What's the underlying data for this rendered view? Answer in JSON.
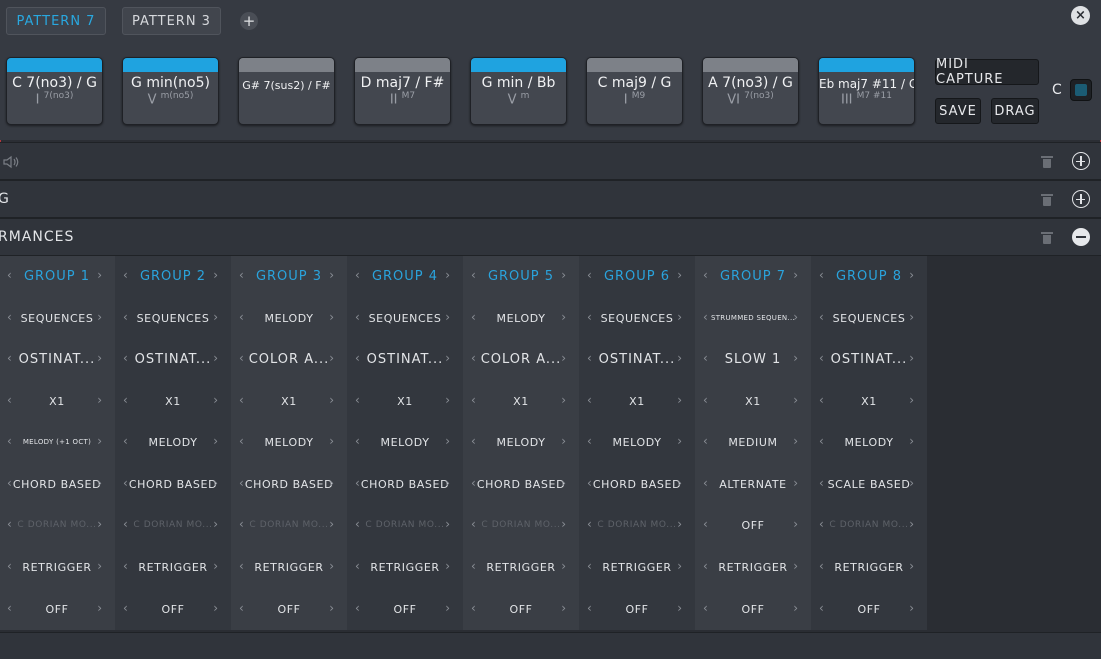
{
  "tabs": [
    {
      "label": "PATTERN 7",
      "active": true
    },
    {
      "label": "PATTERN 3",
      "active": false
    }
  ],
  "add_tab_symbol": "+",
  "close_symbol": "×",
  "chords": [
    {
      "name": "C 7(no3) / G",
      "roman": "I",
      "ext": "7(no3)",
      "selected": true
    },
    {
      "name": "G min(no5)",
      "roman": "V",
      "ext": "m(no5)",
      "selected": true
    },
    {
      "name": "G# 7(sus2) / F#",
      "roman": "",
      "ext": "",
      "selected": false
    },
    {
      "name": "D maj7 / F#",
      "roman": "II",
      "ext": "M7",
      "selected": false
    },
    {
      "name": "G min / Bb",
      "roman": "V",
      "ext": "m",
      "selected": true
    },
    {
      "name": "C maj9 / G",
      "roman": "I",
      "ext": "M9",
      "selected": false
    },
    {
      "name": "A 7(no3) / G",
      "roman": "VI",
      "ext": "7(no3)",
      "selected": false
    },
    {
      "name": "Eb maj7 #11 / G",
      "roman": "III",
      "ext": "M7 #11",
      "selected": true
    }
  ],
  "buttons": {
    "midi_capture": "MIDI CAPTURE",
    "save": "SAVE",
    "drag": "DRAG"
  },
  "key_label": "C",
  "sections": [
    {
      "label": "",
      "icon": "speaker-icon",
      "expanded": false
    },
    {
      "label": "G",
      "icon": "",
      "expanded": false
    },
    {
      "label": "RMANCES",
      "icon": "",
      "expanded": true
    }
  ],
  "groups": [
    {
      "header": "GROUP 1",
      "rows": [
        "SEQUENCES",
        "OSTINAT...",
        "X1",
        "MELODY (+1 OCT)",
        "CHORD BASED",
        "C DORIAN MO...",
        "RETRIGGER",
        "OFF"
      ]
    },
    {
      "header": "GROUP 2",
      "rows": [
        "SEQUENCES",
        "OSTINAT...",
        "X1",
        "MELODY",
        "CHORD BASED",
        "C DORIAN MO...",
        "RETRIGGER",
        "OFF"
      ]
    },
    {
      "header": "GROUP 3",
      "rows": [
        "MELODY",
        "COLOR A...",
        "X1",
        "MELODY",
        "CHORD BASED",
        "C DORIAN MO...",
        "RETRIGGER",
        "OFF"
      ]
    },
    {
      "header": "GROUP 4",
      "rows": [
        "SEQUENCES",
        "OSTINAT...",
        "X1",
        "MELODY",
        "CHORD BASED",
        "C DORIAN MO...",
        "RETRIGGER",
        "OFF"
      ]
    },
    {
      "header": "GROUP 5",
      "rows": [
        "MELODY",
        "COLOR A...",
        "X1",
        "MELODY",
        "CHORD BASED",
        "C DORIAN MO...",
        "RETRIGGER",
        "OFF"
      ]
    },
    {
      "header": "GROUP 6",
      "rows": [
        "SEQUENCES",
        "OSTINAT...",
        "X1",
        "MELODY",
        "CHORD BASED",
        "C DORIAN MO...",
        "RETRIGGER",
        "OFF"
      ]
    },
    {
      "header": "GROUP 7",
      "rows": [
        "STRUMMED SEQUEN...",
        "SLOW 1",
        "X1",
        "MEDIUM",
        "ALTERNATE",
        "OFF",
        "RETRIGGER",
        "OFF"
      ]
    },
    {
      "header": "GROUP 8",
      "rows": [
        "SEQUENCES",
        "OSTINAT...",
        "X1",
        "MELODY",
        "SCALE BASED",
        "C DORIAN MO...",
        "RETRIGGER",
        "OFF"
      ]
    }
  ],
  "colors": {
    "accent": "#1fa3e0",
    "background": "#2b2e34",
    "border": "#b5363c"
  }
}
